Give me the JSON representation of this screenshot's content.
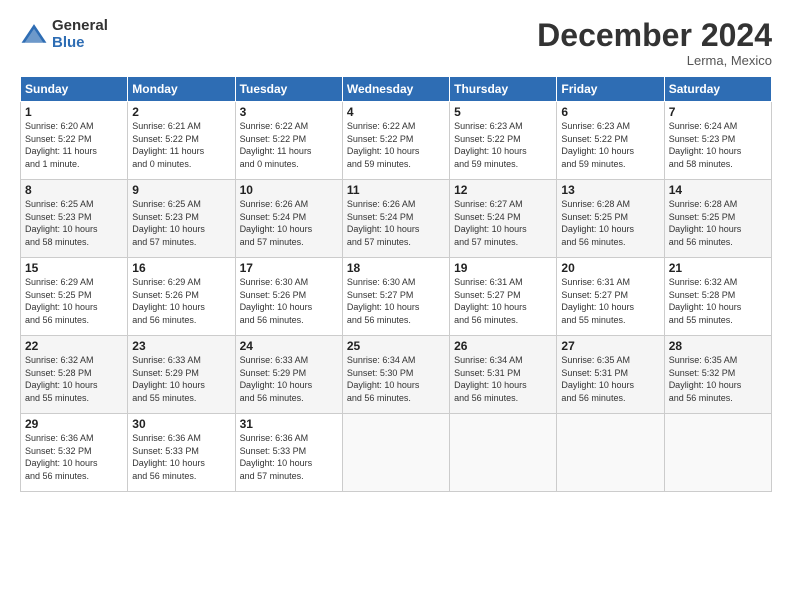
{
  "header": {
    "logo_general": "General",
    "logo_blue": "Blue",
    "month_title": "December 2024",
    "location": "Lerma, Mexico"
  },
  "columns": [
    "Sunday",
    "Monday",
    "Tuesday",
    "Wednesday",
    "Thursday",
    "Friday",
    "Saturday"
  ],
  "weeks": [
    [
      {
        "day": "1",
        "detail": "Sunrise: 6:20 AM\nSunset: 5:22 PM\nDaylight: 11 hours\nand 1 minute."
      },
      {
        "day": "2",
        "detail": "Sunrise: 6:21 AM\nSunset: 5:22 PM\nDaylight: 11 hours\nand 0 minutes."
      },
      {
        "day": "3",
        "detail": "Sunrise: 6:22 AM\nSunset: 5:22 PM\nDaylight: 11 hours\nand 0 minutes."
      },
      {
        "day": "4",
        "detail": "Sunrise: 6:22 AM\nSunset: 5:22 PM\nDaylight: 10 hours\nand 59 minutes."
      },
      {
        "day": "5",
        "detail": "Sunrise: 6:23 AM\nSunset: 5:22 PM\nDaylight: 10 hours\nand 59 minutes."
      },
      {
        "day": "6",
        "detail": "Sunrise: 6:23 AM\nSunset: 5:22 PM\nDaylight: 10 hours\nand 59 minutes."
      },
      {
        "day": "7",
        "detail": "Sunrise: 6:24 AM\nSunset: 5:23 PM\nDaylight: 10 hours\nand 58 minutes."
      }
    ],
    [
      {
        "day": "8",
        "detail": "Sunrise: 6:25 AM\nSunset: 5:23 PM\nDaylight: 10 hours\nand 58 minutes."
      },
      {
        "day": "9",
        "detail": "Sunrise: 6:25 AM\nSunset: 5:23 PM\nDaylight: 10 hours\nand 57 minutes."
      },
      {
        "day": "10",
        "detail": "Sunrise: 6:26 AM\nSunset: 5:24 PM\nDaylight: 10 hours\nand 57 minutes."
      },
      {
        "day": "11",
        "detail": "Sunrise: 6:26 AM\nSunset: 5:24 PM\nDaylight: 10 hours\nand 57 minutes."
      },
      {
        "day": "12",
        "detail": "Sunrise: 6:27 AM\nSunset: 5:24 PM\nDaylight: 10 hours\nand 57 minutes."
      },
      {
        "day": "13",
        "detail": "Sunrise: 6:28 AM\nSunset: 5:25 PM\nDaylight: 10 hours\nand 56 minutes."
      },
      {
        "day": "14",
        "detail": "Sunrise: 6:28 AM\nSunset: 5:25 PM\nDaylight: 10 hours\nand 56 minutes."
      }
    ],
    [
      {
        "day": "15",
        "detail": "Sunrise: 6:29 AM\nSunset: 5:25 PM\nDaylight: 10 hours\nand 56 minutes."
      },
      {
        "day": "16",
        "detail": "Sunrise: 6:29 AM\nSunset: 5:26 PM\nDaylight: 10 hours\nand 56 minutes."
      },
      {
        "day": "17",
        "detail": "Sunrise: 6:30 AM\nSunset: 5:26 PM\nDaylight: 10 hours\nand 56 minutes."
      },
      {
        "day": "18",
        "detail": "Sunrise: 6:30 AM\nSunset: 5:27 PM\nDaylight: 10 hours\nand 56 minutes."
      },
      {
        "day": "19",
        "detail": "Sunrise: 6:31 AM\nSunset: 5:27 PM\nDaylight: 10 hours\nand 56 minutes."
      },
      {
        "day": "20",
        "detail": "Sunrise: 6:31 AM\nSunset: 5:27 PM\nDaylight: 10 hours\nand 55 minutes."
      },
      {
        "day": "21",
        "detail": "Sunrise: 6:32 AM\nSunset: 5:28 PM\nDaylight: 10 hours\nand 55 minutes."
      }
    ],
    [
      {
        "day": "22",
        "detail": "Sunrise: 6:32 AM\nSunset: 5:28 PM\nDaylight: 10 hours\nand 55 minutes."
      },
      {
        "day": "23",
        "detail": "Sunrise: 6:33 AM\nSunset: 5:29 PM\nDaylight: 10 hours\nand 55 minutes."
      },
      {
        "day": "24",
        "detail": "Sunrise: 6:33 AM\nSunset: 5:29 PM\nDaylight: 10 hours\nand 56 minutes."
      },
      {
        "day": "25",
        "detail": "Sunrise: 6:34 AM\nSunset: 5:30 PM\nDaylight: 10 hours\nand 56 minutes."
      },
      {
        "day": "26",
        "detail": "Sunrise: 6:34 AM\nSunset: 5:31 PM\nDaylight: 10 hours\nand 56 minutes."
      },
      {
        "day": "27",
        "detail": "Sunrise: 6:35 AM\nSunset: 5:31 PM\nDaylight: 10 hours\nand 56 minutes."
      },
      {
        "day": "28",
        "detail": "Sunrise: 6:35 AM\nSunset: 5:32 PM\nDaylight: 10 hours\nand 56 minutes."
      }
    ],
    [
      {
        "day": "29",
        "detail": "Sunrise: 6:36 AM\nSunset: 5:32 PM\nDaylight: 10 hours\nand 56 minutes."
      },
      {
        "day": "30",
        "detail": "Sunrise: 6:36 AM\nSunset: 5:33 PM\nDaylight: 10 hours\nand 56 minutes."
      },
      {
        "day": "31",
        "detail": "Sunrise: 6:36 AM\nSunset: 5:33 PM\nDaylight: 10 hours\nand 57 minutes."
      },
      {
        "day": "",
        "detail": ""
      },
      {
        "day": "",
        "detail": ""
      },
      {
        "day": "",
        "detail": ""
      },
      {
        "day": "",
        "detail": ""
      }
    ]
  ]
}
